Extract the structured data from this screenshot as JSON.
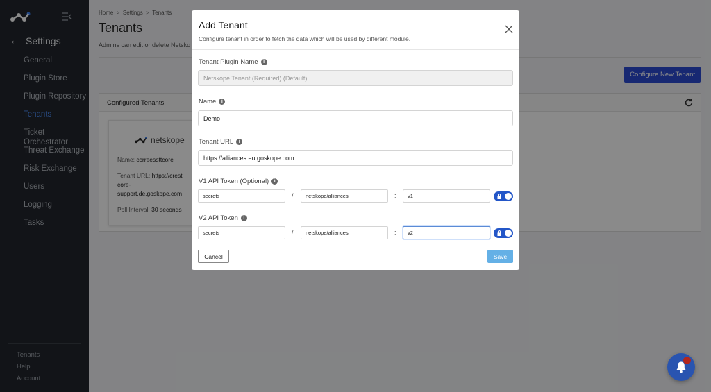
{
  "sidebar": {
    "heading": "Settings",
    "items": [
      {
        "label": "General"
      },
      {
        "label": "Plugin Store"
      },
      {
        "label": "Plugin Repository"
      },
      {
        "label": "Tenants"
      },
      {
        "label": "Ticket Orchestrator"
      },
      {
        "label": "Threat Exchange"
      },
      {
        "label": "Risk Exchange"
      },
      {
        "label": "Users"
      },
      {
        "label": "Logging"
      },
      {
        "label": "Tasks"
      }
    ],
    "footer": [
      "Tenants",
      "Help",
      "Account"
    ]
  },
  "page": {
    "breadcrumb": "Home  >  Settings  >  Tenants",
    "title": "Tenants",
    "description": "Admins can edit or delete Netsko",
    "configure_button": "Configure New Tenant",
    "panel_title": "Configured Tenants",
    "card": {
      "logo_text": "netskope",
      "name_label": "Name:",
      "name_value": "ccrreessttcore",
      "url_label": "Tenant URL:",
      "url_value_1": "https://crest",
      "url_value_2": "core-",
      "url_value_3": "support.de.goskope.com",
      "poll_label": "Poll Interval:",
      "poll_value": "30 seconds"
    }
  },
  "modal": {
    "title": "Add Tenant",
    "subtitle": "Configure tenant in order to fetch the data which will be used by different module.",
    "plugin_label": "Tenant Plugin Name",
    "plugin_value": "Netskope Tenant (Required) (Default)",
    "name_label": "Name",
    "name_value": "Demo",
    "url_label": "Tenant URL",
    "url_value": "https://alliances.eu.goskope.com",
    "v1_label": "V1 API Token (Optional)",
    "v1_fields": [
      "secrets",
      "netskope/alliances",
      "v1"
    ],
    "v2_label": "V2 API Token",
    "v2_fields": [
      "secrets",
      "netskope/alliances",
      "v2"
    ],
    "slash": "/",
    "colon": ":",
    "cancel": "Cancel",
    "save": "Save"
  },
  "notifications": {
    "badge": "!"
  },
  "colors": {
    "accent": "#2b4bd3",
    "sidebar_bg": "#22262d",
    "active_nav": "#4d8ef7",
    "save": "#64b0e6"
  }
}
